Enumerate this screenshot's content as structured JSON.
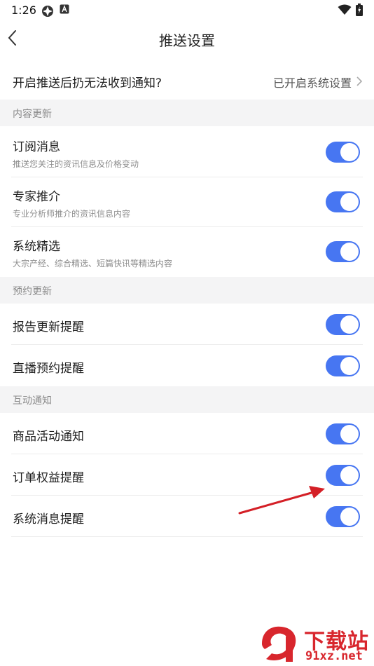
{
  "status_bar": {
    "time": "1:26"
  },
  "header": {
    "title": "推送设置"
  },
  "notice": {
    "title": "开启推送后扔无法收到通知?",
    "status": "已开启系统设置"
  },
  "sections": [
    {
      "label": "内容更新",
      "items": [
        {
          "title": "订阅消息",
          "subtitle": "推送您关注的资讯信息及价格变动",
          "enabled": true
        },
        {
          "title": "专家推介",
          "subtitle": "专业分析师推介的资讯信息内容",
          "enabled": true
        },
        {
          "title": "系统精选",
          "subtitle": "大宗产经、综合精选、短篇快讯等精选内容",
          "enabled": true
        }
      ]
    },
    {
      "label": "预约更新",
      "items": [
        {
          "title": "报告更新提醒",
          "enabled": true
        },
        {
          "title": "直播预约提醒",
          "enabled": true
        }
      ]
    },
    {
      "label": "互动通知",
      "items": [
        {
          "title": "商品活动通知",
          "enabled": true
        },
        {
          "title": "订单权益提醒",
          "enabled": true
        },
        {
          "title": "系统消息提醒",
          "enabled": true
        }
      ]
    }
  ],
  "watermark": {
    "title": "下载站",
    "url": "91xz.net"
  },
  "colors": {
    "toggle_on": "#4776f2",
    "section_bg": "#f4f4f5",
    "annotation_arrow": "#d41f26",
    "watermark": "#d8262d"
  }
}
